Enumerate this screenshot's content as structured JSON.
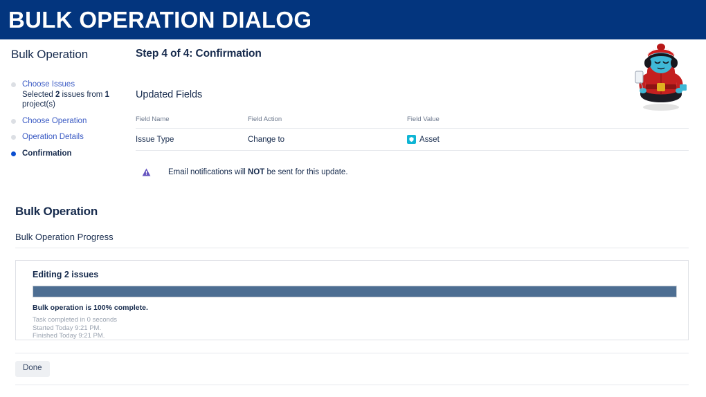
{
  "banner": {
    "title": "BULK OPERATION DIALOG",
    "background_color": "#03357e",
    "text_color": "#ffffff"
  },
  "dialog": {
    "sidebar": {
      "title": "Bulk Operation",
      "steps": [
        {
          "label": "Choose Issues",
          "state": "done",
          "sublabel_prefix": "Selected ",
          "sublabel_count": "2",
          "sublabel_mid": " issues from ",
          "sublabel_projects": "1",
          "sublabel_suffix": " project(s)"
        },
        {
          "label": "Choose Operation",
          "state": "done"
        },
        {
          "label": "Operation Details",
          "state": "done"
        },
        {
          "label": "Confirmation",
          "state": "active"
        }
      ],
      "active_bullet_color": "#0b4fd0",
      "inactive_bullet_color": "#dcdfe4",
      "link_color": "#3b5bc4"
    },
    "main": {
      "step_heading": "Step 4 of 4: Confirmation",
      "section_heading": "Updated Fields",
      "table": {
        "columns": [
          "Field Name",
          "Field Action",
          "Field Value"
        ],
        "rows": [
          {
            "field_name": "Issue Type",
            "field_action": "Change to",
            "field_value": "Asset",
            "field_value_icon": "asset-icon",
            "field_value_icon_color": "#0fb5d4"
          }
        ]
      },
      "notice": {
        "icon": "warning-triangle-icon",
        "icon_color": "#6554c0",
        "text_before": "Email notifications will ",
        "text_emphasis": "NOT",
        "text_after": " be sent for this update."
      }
    },
    "mascot": {
      "name": "meditating-mascot-illustration",
      "turban_color": "#d01f1f",
      "face_color": "#3fb8d6",
      "robe_color": "#c42020"
    }
  },
  "progress_section": {
    "title": "Bulk Operation",
    "subtitle": "Bulk Operation Progress",
    "panel": {
      "heading": "Editing 2 issues",
      "progress_percent": 100,
      "bar_color": "#4d6e92",
      "status": "Bulk operation is 100% complete.",
      "meta_lines": [
        "Task completed in 0 seconds",
        "Started Today 9:21 PM.",
        "Finished Today 9:21 PM."
      ]
    },
    "footer": {
      "done_label": "Done"
    }
  }
}
